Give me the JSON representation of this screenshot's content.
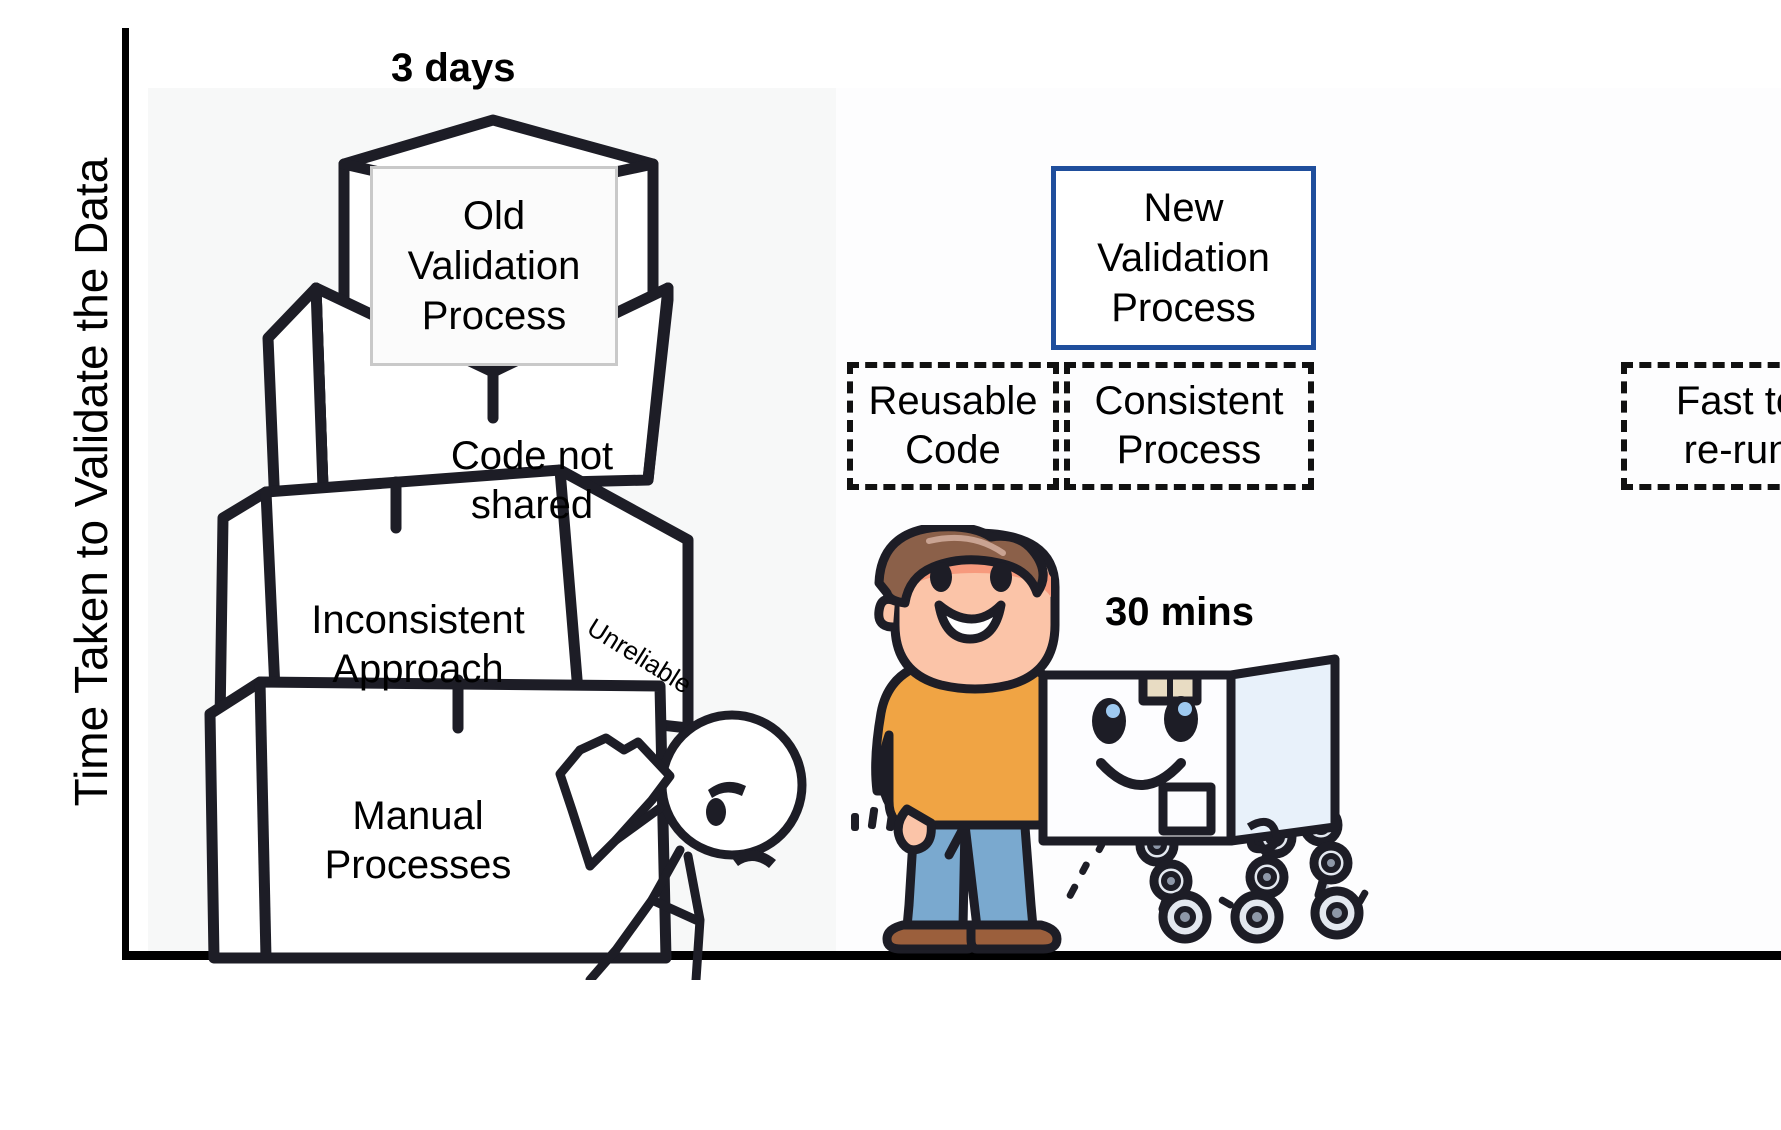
{
  "chart_data": {
    "type": "bar",
    "title": "",
    "ylabel": "Time Taken to Validate the Data",
    "xlabel": "",
    "categories": [
      "Old Validation Process",
      "New Validation Process"
    ],
    "values": [
      3,
      0.02
    ],
    "value_labels": [
      "3 days",
      "30 mins"
    ],
    "value_units": [
      "days",
      "mins"
    ],
    "grid": false,
    "legend": "none",
    "notes": "Left column: towering stack of boxes labelled with old-process problems, height = 3 days. Right column: short/efficient new process, height = 30 mins."
  },
  "axis": {
    "y_label": "Time Taken to Validate the Data"
  },
  "left_column": {
    "headline": "3 days",
    "process_label": "Old\nValidation\nProcess",
    "boxes": [
      {
        "id": "code-not-shared",
        "label": "Code not\nshared"
      },
      {
        "id": "inconsistent-approach",
        "label": "Inconsistent\nApproach"
      },
      {
        "id": "manual-processes",
        "label": "Manual\nProcesses"
      }
    ],
    "side_panel_label": "Unreliable",
    "character": "frustrated-stick-figure"
  },
  "right_column": {
    "headline": "30 mins",
    "process_label": "New\nValidation\nProcess",
    "process_border_color": "#1f4e9c",
    "benefit_boxes": [
      {
        "id": "reusable-code",
        "label": "Reusable\nCode"
      },
      {
        "id": "consistent-process",
        "label": "Consistent\nProcess"
      },
      {
        "id": "fast-to-re-run",
        "label": "Fast to\nre-run"
      }
    ],
    "characters": [
      "smiling-person",
      "robot-box"
    ]
  },
  "colors": {
    "accent_blue": "#1f4e9c",
    "outline_black": "#1d1d26",
    "shirt_orange": "#f0a444",
    "jeans_blue": "#7aa9cf",
    "skin": "#fbc4a8",
    "hair_brown": "#8b6049",
    "shoe_brown": "#9b5f3c",
    "robot_body": "#fdfdff",
    "robot_side": "#e8f1fa",
    "tape_tan": "#e8dcc3",
    "metal_grey": "#c3cad6"
  }
}
